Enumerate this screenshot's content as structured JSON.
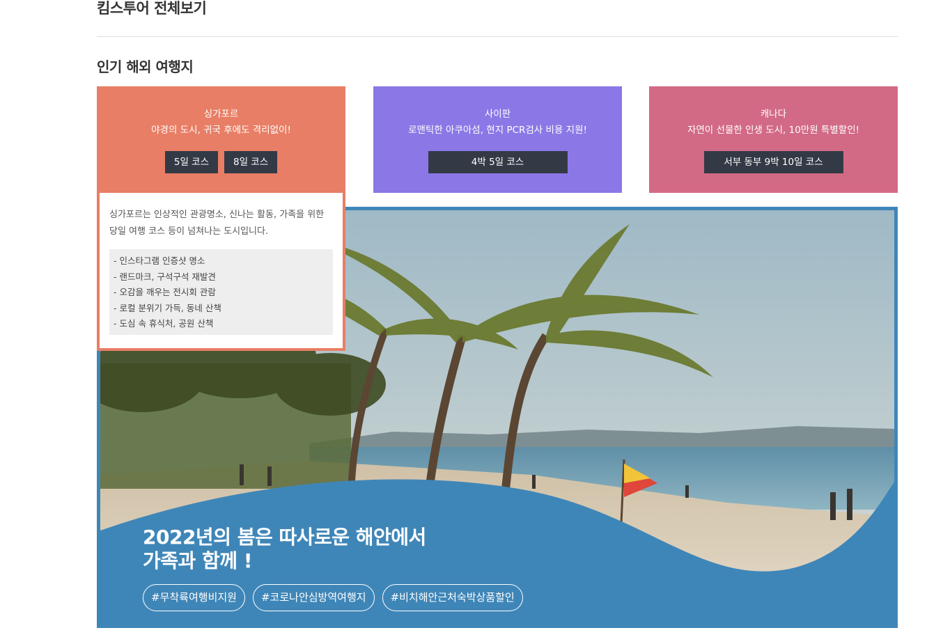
{
  "header": {
    "title": "킴스투어 전체보기"
  },
  "section": {
    "title": "인기 해외 여행지"
  },
  "cards": [
    {
      "name": "싱가포르",
      "desc": "야경의 도시, 귀국 후에도 격리없이!",
      "buttons": [
        "5일 코스",
        "8일 코스"
      ],
      "color": "#e87e65"
    },
    {
      "name": "사이판",
      "desc": "로맨틱한 아쿠아섬, 현지 PCR검사 비용 지원!",
      "buttons": [
        "4박 5일 코스"
      ],
      "color": "#8b78e6"
    },
    {
      "name": "캐나다",
      "desc": "자연이 선물한 인생 도시, 10만원 특별할인!",
      "buttons": [
        "서부 동부 9박 10일 코스"
      ],
      "color": "#d26a85"
    }
  ],
  "detail": {
    "intro": "싱가포르는 인상적인 관광명소, 신나는 활동, 가족을 위한 당일 여행 코스 등이 넘쳐나는 도시입니다.",
    "items": [
      "- 인스타그램 인증샷 명소",
      "- 랜드마크, 구석구석 재발견",
      "- 오감을 깨우는 전시회 관람",
      "- 로컬 분위기 가득, 동네 산책",
      "- 도심 속 휴식처, 공원 산책"
    ]
  },
  "hero": {
    "headline_line1": "2022년의 봄은 따사로운 해안에서",
    "headline_line2": "가족과 함께 !",
    "tags": [
      "#무착륙여행비지원",
      "#코로나안심방역여행지",
      "#비치해안근처숙박상품할인"
    ],
    "frame_color": "#3f86b8",
    "image": "beach-with-palm-trees"
  }
}
